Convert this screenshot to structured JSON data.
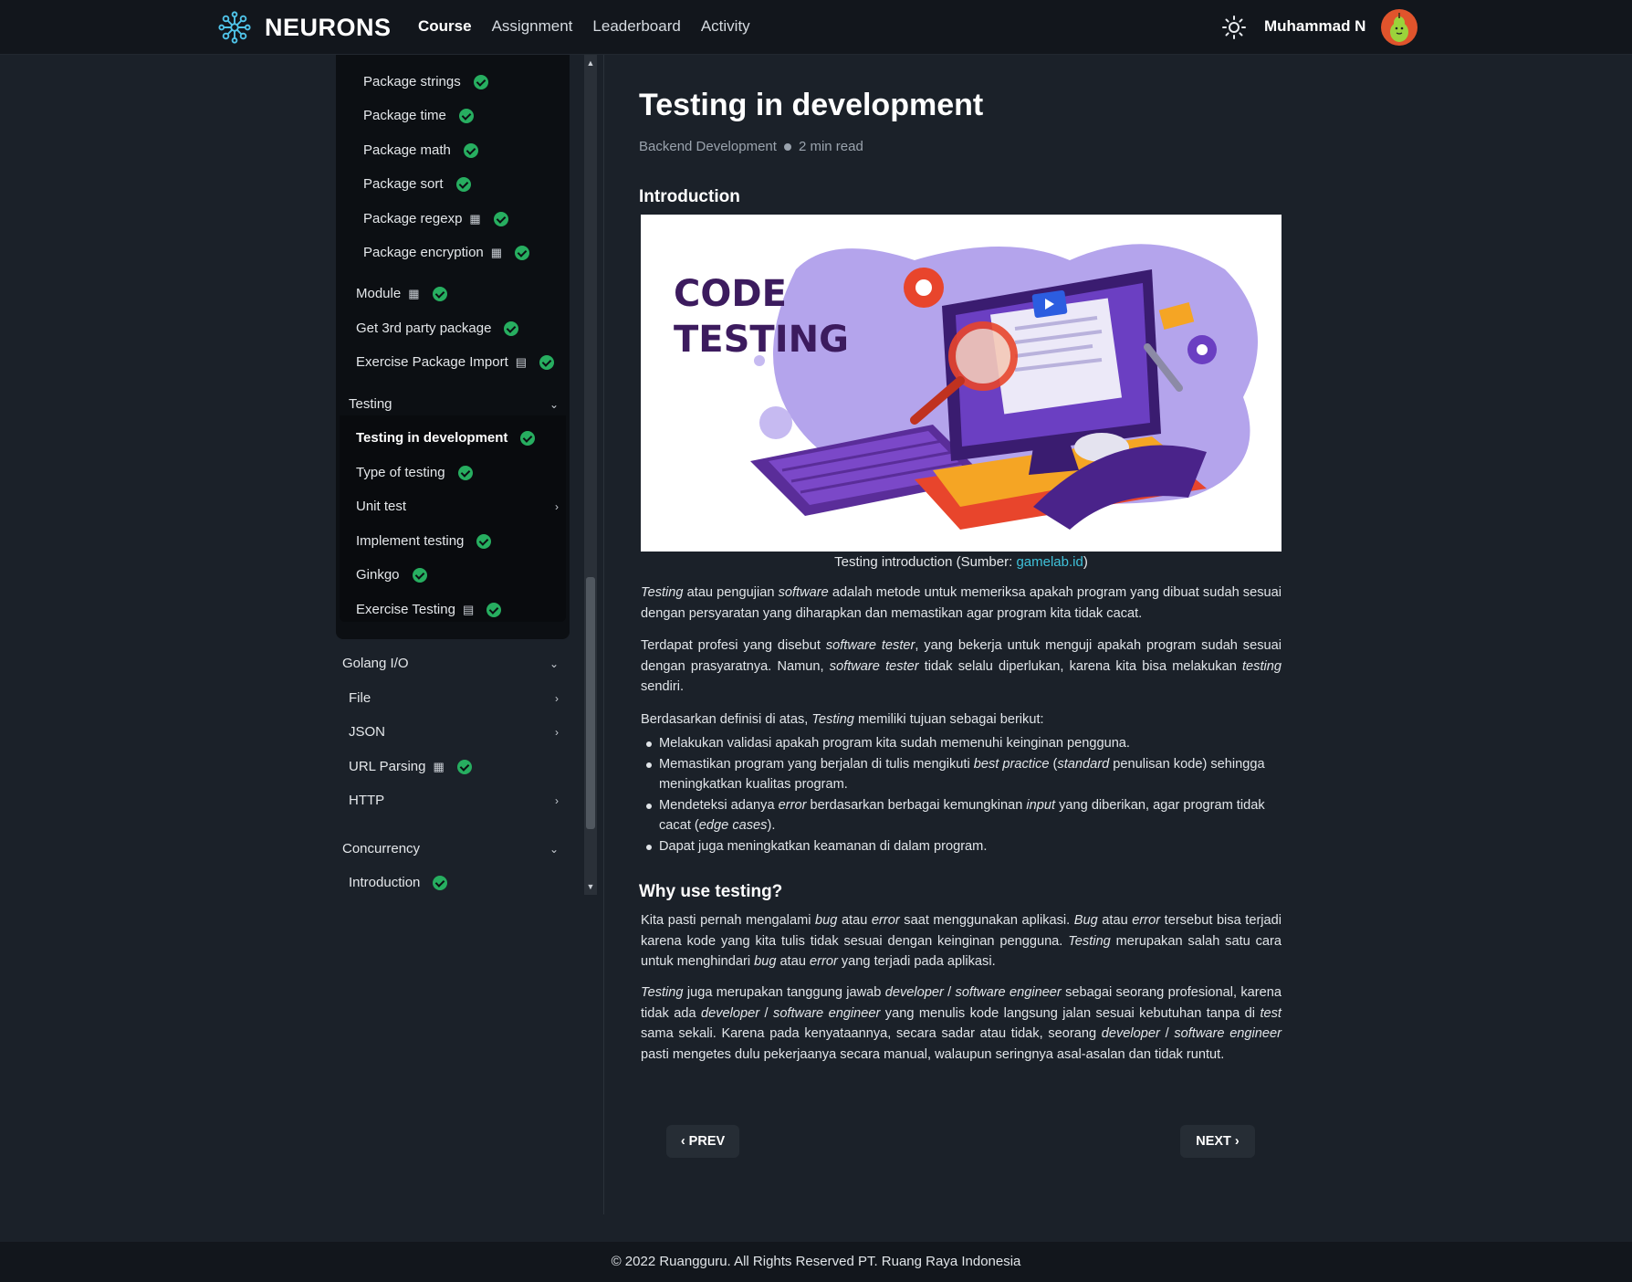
{
  "navbar": {
    "brand": "NEURONS",
    "links": [
      "Course",
      "Assignment",
      "Leaderboard",
      "Activity"
    ],
    "active_link": "Course",
    "user_name": "Muhammad N"
  },
  "sidebar": {
    "package_items": [
      "Package strings",
      "Package time",
      "Package math",
      "Package sort",
      "Package regexp",
      "Package encryption"
    ],
    "module_items": [
      "Module",
      "Get 3rd party package",
      "Exercise Package Import"
    ],
    "testing_section": "Testing",
    "testing_items": [
      "Testing in development",
      "Type of testing",
      "Unit test",
      "Implement testing",
      "Ginkgo",
      "Exercise Testing"
    ],
    "io_section": "Golang I/O",
    "io_items": [
      "File",
      "JSON",
      "URL Parsing",
      "HTTP"
    ],
    "concurrency_section": "Concurrency",
    "concurrency_items": [
      "Introduction"
    ]
  },
  "article": {
    "title": "Testing in development",
    "category": "Backend Development",
    "read_time": "2 min read",
    "intro_heading": "Introduction",
    "hero_text_line1": "CODE",
    "hero_text_line2": "TESTING",
    "caption_prefix": "Testing introduction (Sumber: ",
    "caption_link": "gamelab.id",
    "caption_suffix": ")",
    "why_heading": "Why use testing?"
  },
  "pagination": {
    "prev": "PREV",
    "next": "NEXT"
  },
  "footer": {
    "text": "© 2022 Ruangguru. All Rights Reserved PT. Ruang Raya Indonesia"
  },
  "colors": {
    "accent_link": "#3fc1d9",
    "check_green": "#27ae60",
    "background": "#1b2129"
  }
}
